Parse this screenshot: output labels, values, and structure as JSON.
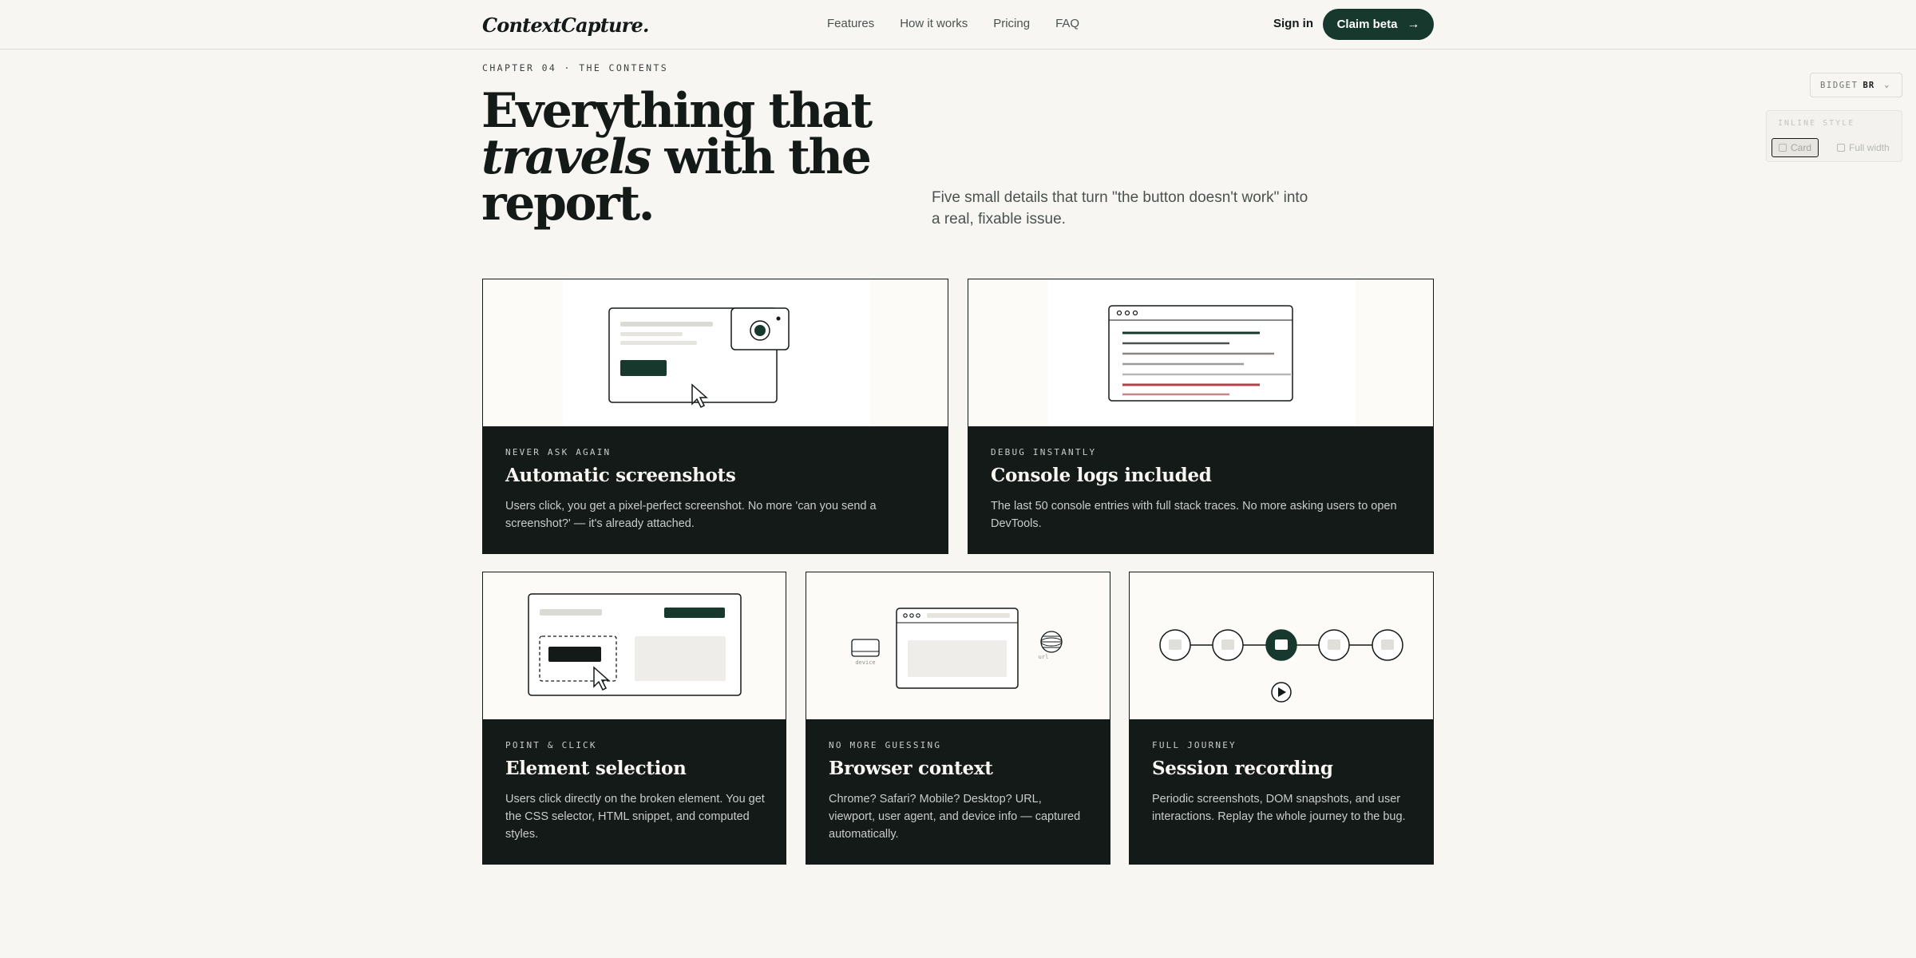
{
  "nav": {
    "logo": "ContextCapture.",
    "links": [
      "Features",
      "How it works",
      "Pricing",
      "FAQ"
    ],
    "signin": "Sign in",
    "cta": "Claim beta"
  },
  "hero": {
    "eyebrow": "CHAPTER 04 · THE CONTENTS",
    "headline_line1": "Everything that",
    "headline_em": "travels",
    "headline_line2_rest": " with the",
    "headline_line3": "report.",
    "lede": "Five small details that turn \"the button doesn't work\" into a real, fixable issue."
  },
  "widget": {
    "select_prefix": "BIDGET",
    "select_value": "BR",
    "panel_title": "INLINE STYLE",
    "options": [
      "Card",
      "Full width"
    ]
  },
  "features": [
    {
      "kicker": "NEVER ASK AGAIN",
      "title": "Automatic screenshots",
      "desc": "Users click, you get a pixel-perfect screenshot. No more 'can you send a screenshot?' — it's already attached."
    },
    {
      "kicker": "DEBUG INSTANTLY",
      "title": "Console logs included",
      "desc": "The last 50 console entries with full stack traces. No more asking users to open DevTools."
    },
    {
      "kicker": "POINT & CLICK",
      "title": "Element selection",
      "desc": "Users click directly on the broken element. You get the CSS selector, HTML snippet, and computed styles."
    },
    {
      "kicker": "NO MORE GUESSING",
      "title": "Browser context",
      "desc": "Chrome? Safari? Mobile? Desktop? URL, viewport, user agent, and device info — captured automatically.",
      "illus_labels": [
        "device",
        "url"
      ]
    },
    {
      "kicker": "FULL JOURNEY",
      "title": "Session recording",
      "desc": "Periodic screenshots, DOM snapshots, and user interactions. Replay the whole journey to the bug."
    }
  ],
  "colors": {
    "accent": "#17382d",
    "ink": "#141a18",
    "paper": "#f7f6f2",
    "error_line": "#b0424a"
  }
}
